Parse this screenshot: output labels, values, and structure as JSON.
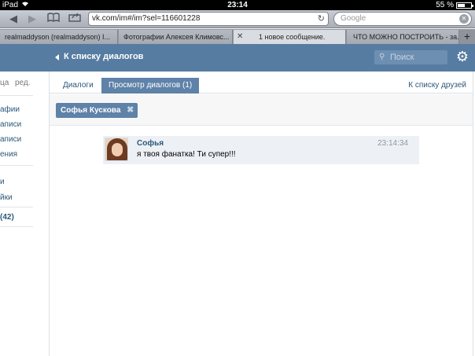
{
  "status_bar": {
    "device": "iPad",
    "time": "23:14",
    "battery": "55 %",
    "battery_level": 0.55
  },
  "browser": {
    "url": "vk.com/im#/im?sel=116601228",
    "search_placeholder": "Google",
    "tabs": [
      {
        "label": "realmaddyson (realmaddyson) I..."
      },
      {
        "label": "Фотографии Алексея Климовс..."
      },
      {
        "label": "1 новое сообщение."
      },
      {
        "label": "ЧТО МОЖНО ПОСТРОИТЬ - за..."
      }
    ]
  },
  "header": {
    "back_label": "К списку диалогов",
    "search_placeholder": "Поиск"
  },
  "left_menu": {
    "top_left": "ца",
    "top_right": "ред.",
    "items": [
      "афии",
      "аписи",
      "аписи",
      "ения",
      "и",
      "йки"
    ],
    "count_label": "(42)"
  },
  "main": {
    "tabs": [
      {
        "label": "Диалоги",
        "active": false
      },
      {
        "label": "Просмотр диалогов (1)",
        "active": true
      }
    ],
    "friends_link": "К списку друзей",
    "filter_chip": "Софья Кускова",
    "message": {
      "author": "Софья",
      "text": "я твоя фанатка! Ти супер!!!",
      "time": "23:14:34"
    }
  },
  "colors": {
    "vk_blue": "#577ca1",
    "tab_active": "#5e82a8",
    "link": "#2b587a"
  }
}
